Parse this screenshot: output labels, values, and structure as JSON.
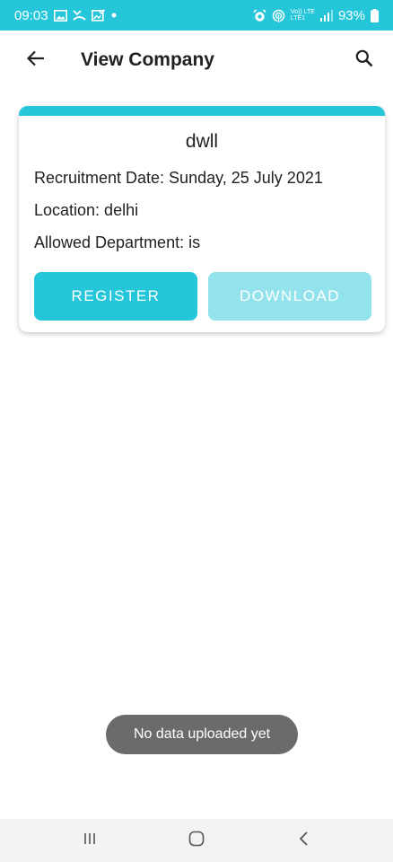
{
  "status_bar": {
    "time": "09:03",
    "battery": "93%",
    "network_top": "Vo)) LTE",
    "network_bottom": "LTE1",
    "icons": [
      "gallery-icon",
      "missed-call-icon",
      "image-check-icon",
      "dot-icon",
      "alarm-icon",
      "hotspot-icon",
      "signal-icon",
      "battery-icon"
    ]
  },
  "app_bar": {
    "title": "View Company",
    "back_icon": "arrow-left-icon",
    "search_icon": "search-icon"
  },
  "company": {
    "name": "dwll",
    "recruitment_date": "Recruitment Date: Sunday, 25 July 2021",
    "location": "Location: delhi",
    "allowed_department": "Allowed Department: is"
  },
  "actions": {
    "register_label": "REGISTER",
    "download_label": "DOWNLOAD"
  },
  "toast": {
    "message": "No data uploaded yet"
  },
  "nav_bar": {
    "icons": [
      "recent-apps-icon",
      "home-icon",
      "back-icon"
    ]
  },
  "colors": {
    "accent": "#26c6da",
    "accent_disabled": "#93e3ec",
    "toast_bg": "#6b6b6b",
    "nav_bg": "#f3f3f3"
  }
}
